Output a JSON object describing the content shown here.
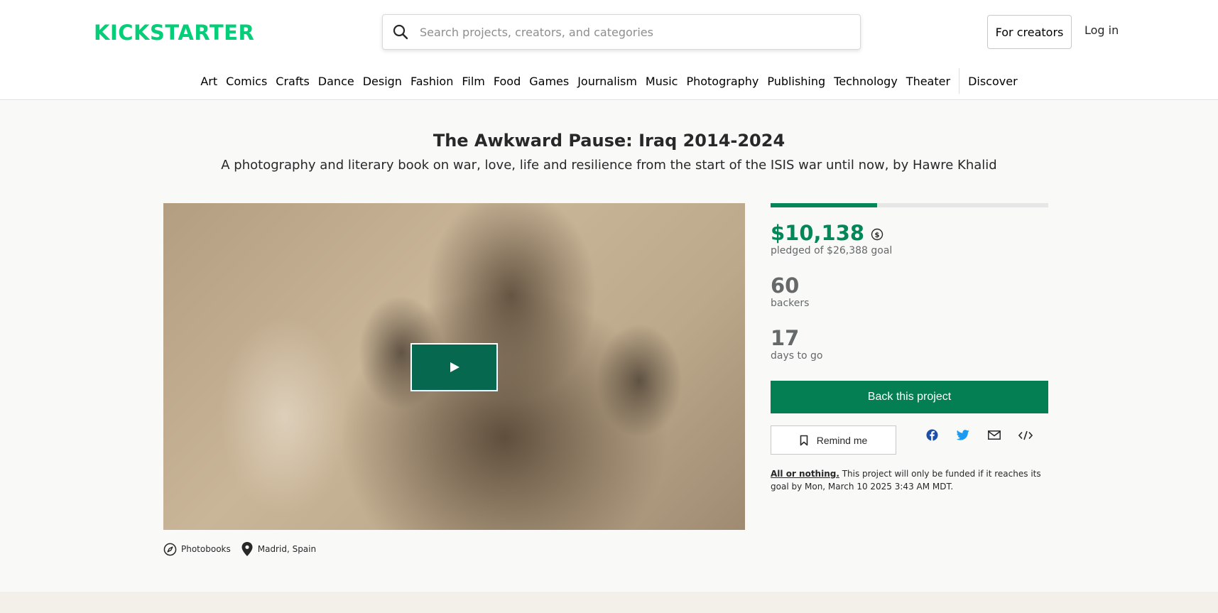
{
  "header": {
    "logo_text": "KICKSTARTER",
    "search_placeholder": "Search projects, creators, and categories",
    "for_creators_label": "For creators",
    "login_label": "Log in"
  },
  "categories": [
    "Art",
    "Comics",
    "Crafts",
    "Dance",
    "Design",
    "Fashion",
    "Film",
    "Food",
    "Games",
    "Journalism",
    "Music",
    "Photography",
    "Publishing",
    "Technology",
    "Theater"
  ],
  "discover_label": "Discover",
  "project": {
    "title": "The Awkward Pause: Iraq 2014-2024",
    "subtitle": "A photography and literary book on war, love, life and resilience from the start of the ISIS war until now, by Hawre Khalid",
    "category": "Photobooks",
    "location": "Madrid, Spain"
  },
  "stats": {
    "progress_fraction": 0.384,
    "pledged": "$10,138",
    "pledged_label": "pledged of $26,388 goal",
    "backers": "60",
    "backers_label": "backers",
    "days": "17",
    "days_label": "days to go",
    "back_label": "Back this project",
    "remind_label": "Remind me",
    "aon_link": "All or nothing.",
    "aon_text": " This project will only be funded if it reaches its goal by Mon, March 10 2025 3:43 AM MDT."
  },
  "colors": {
    "brand": "#05ce78",
    "primary": "#037f53",
    "play": "#05684f"
  },
  "icons": {
    "search": "search-icon",
    "currency": "currency-conversion-icon",
    "play": "play-icon",
    "category": "compass-icon",
    "location": "location-pin-icon",
    "bookmark": "bookmark-icon",
    "facebook": "facebook-icon",
    "twitter": "twitter-icon",
    "email": "email-icon",
    "embed": "embed-code-icon"
  }
}
